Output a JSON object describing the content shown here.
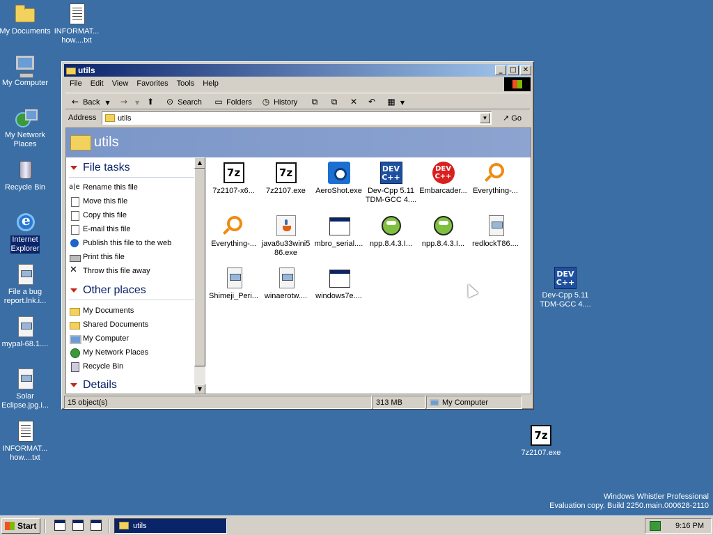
{
  "desktop_icons": [
    {
      "label": "My Documents",
      "icon": "folder-icon"
    },
    {
      "label": "INFORMAT...\nhow....txt",
      "icon": "text-file-icon"
    },
    {
      "label": "My Computer",
      "icon": "computer-icon"
    },
    {
      "label": "My Network\nPlaces",
      "icon": "network-icon"
    },
    {
      "label": "Recycle Bin",
      "icon": "recycle-bin-icon"
    },
    {
      "label": "Internet\nExplorer",
      "icon": "ie-icon"
    },
    {
      "label": "File a bug\nreport.lnk.i...",
      "icon": "image-file-icon"
    },
    {
      "label": "mypal-68.1....",
      "icon": "image-file-icon"
    },
    {
      "label": "Solar\nEclipse.jpg.i...",
      "icon": "image-file-icon"
    },
    {
      "label": "INFORMAT...\nhow....txt",
      "icon": "text-file-icon"
    },
    {
      "label": "Dev-Cpp 5.11\nTDM-GCC 4....",
      "icon": "devcpp-icon"
    },
    {
      "label": "7z2107.exe",
      "icon": "7zip-icon"
    }
  ],
  "window": {
    "title": "utils",
    "menu": [
      "File",
      "Edit",
      "View",
      "Favorites",
      "Tools",
      "Help"
    ],
    "toolbar": {
      "back": "Back",
      "search": "Search",
      "folders": "Folders",
      "history": "History"
    },
    "address": {
      "label": "Address",
      "value": "utils",
      "go": "Go"
    },
    "banner_title": "utils",
    "file_tasks": {
      "heading": "File tasks",
      "items": [
        {
          "label": "Rename this file",
          "icon": "rename-icon"
        },
        {
          "label": "Move this file",
          "icon": "move-icon"
        },
        {
          "label": "Copy this file",
          "icon": "copy-icon"
        },
        {
          "label": "E-mail this file",
          "icon": "email-icon"
        },
        {
          "label": "Publish this file to the web",
          "icon": "globe-icon"
        },
        {
          "label": "Print this file",
          "icon": "printer-icon"
        },
        {
          "label": "Throw this file away",
          "icon": "delete-icon"
        }
      ]
    },
    "other_places": {
      "heading": "Other places",
      "items": [
        {
          "label": "My Documents",
          "icon": "folder-icon"
        },
        {
          "label": "Shared Documents",
          "icon": "folder-icon"
        },
        {
          "label": "My Computer",
          "icon": "computer-icon"
        },
        {
          "label": "My Network Places",
          "icon": "network-icon"
        },
        {
          "label": "Recycle Bin",
          "icon": "recycle-bin-icon"
        }
      ]
    },
    "details_heading": "Details",
    "files": [
      {
        "name": "7z2107-x6...",
        "icon": "7zip-icon"
      },
      {
        "name": "7z2107.exe",
        "icon": "7zip-icon"
      },
      {
        "name": "AeroShot.exe",
        "icon": "camera-icon"
      },
      {
        "name": "Dev-Cpp 5.11\nTDM-GCC 4....",
        "icon": "devcpp-icon"
      },
      {
        "name": "Embarcader...",
        "icon": "embarcadero-icon"
      },
      {
        "name": "Everything-...",
        "icon": "magnifier-icon"
      },
      {
        "name": "Everything-...",
        "icon": "magnifier-icon"
      },
      {
        "name": "java6u33wini5\n86.exe",
        "icon": "java-icon"
      },
      {
        "name": "mbro_serial....",
        "icon": "window-icon"
      },
      {
        "name": "npp.8.4.3.I...",
        "icon": "notepadpp-icon"
      },
      {
        "name": "npp.8.4.3.I...",
        "icon": "notepadpp-icon"
      },
      {
        "name": "redlockT86....",
        "icon": "image-file-icon"
      },
      {
        "name": "Shimeji_Peri...",
        "icon": "image-file-icon"
      },
      {
        "name": "winaerotw....",
        "icon": "image-file-icon"
      },
      {
        "name": "windows7e....",
        "icon": "window-icon"
      }
    ],
    "status": {
      "objects": "15 object(s)",
      "size": "313 MB",
      "location": "My Computer"
    }
  },
  "watermark": {
    "line1": "Windows Whistler Professional",
    "line2": "Evaluation copy. Build 2250.main.000628-2110"
  },
  "taskbar": {
    "start": "Start",
    "task": "utils",
    "clock": "9:16 PM"
  }
}
